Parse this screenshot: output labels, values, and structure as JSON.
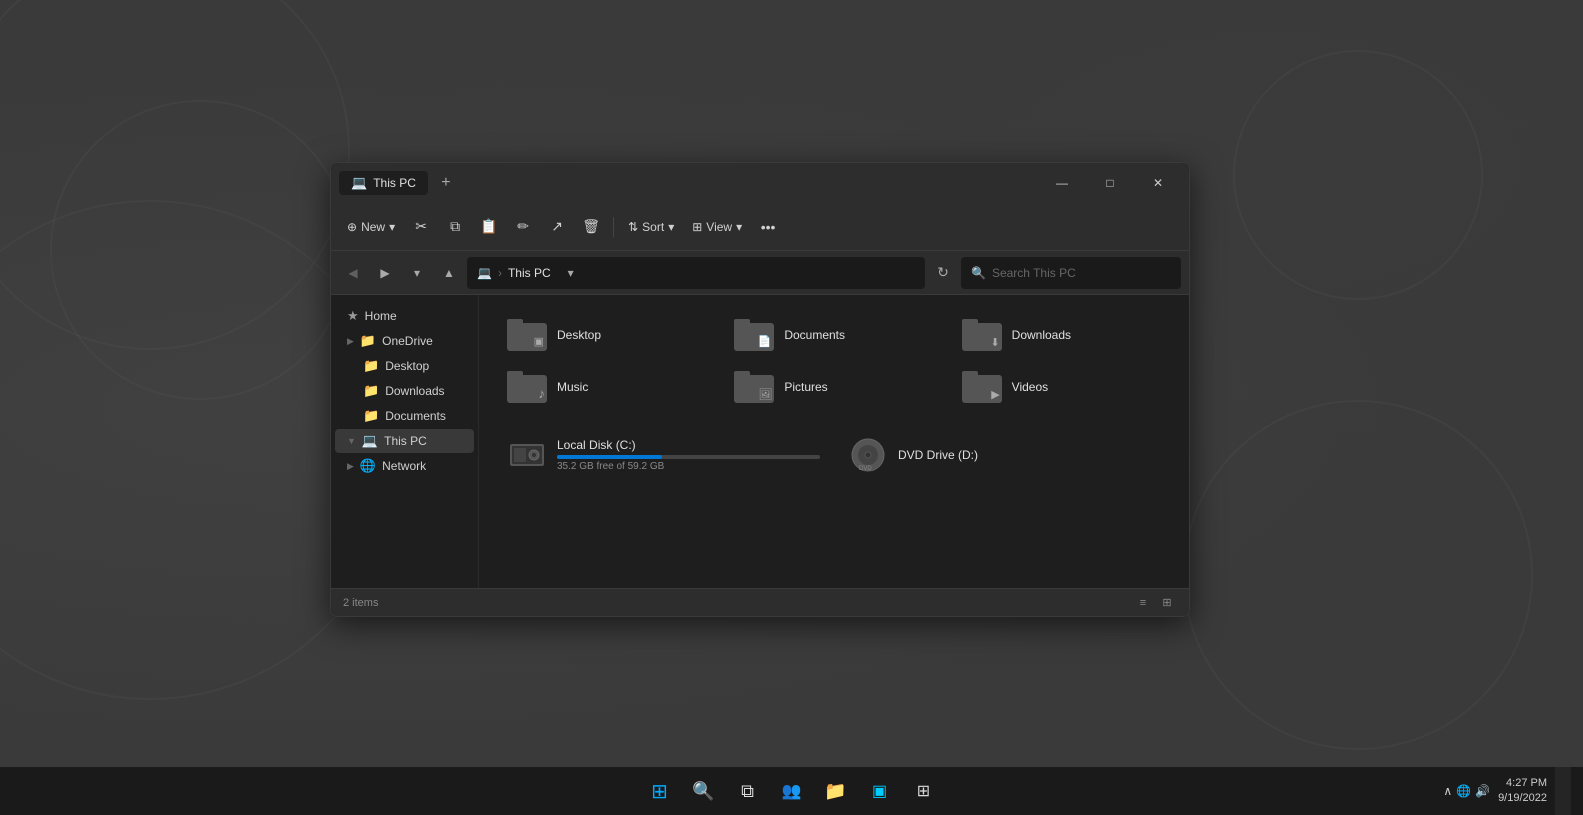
{
  "window": {
    "title": "This PC",
    "tab_label": "This PC",
    "add_tab": "+",
    "minimize": "—",
    "maximize": "□",
    "close": "✕"
  },
  "toolbar": {
    "new_label": "New",
    "sort_label": "Sort",
    "view_label": "View",
    "more_label": "•••",
    "new_chevron": "▾",
    "sort_chevron": "▾",
    "view_chevron": "▾"
  },
  "addressbar": {
    "pc_icon": "💻",
    "path_separator": ">",
    "path_text": "This PC",
    "refresh_icon": "↻",
    "search_placeholder": "Search This PC",
    "search_icon": "🔍"
  },
  "sidebar": {
    "items": [
      {
        "id": "home",
        "label": "Home",
        "icon": "★",
        "indent": 0,
        "has_chevron": false
      },
      {
        "id": "onedrive",
        "label": "OneDrive",
        "icon": "📁",
        "indent": 0,
        "has_chevron": true
      },
      {
        "id": "desktop-side",
        "label": "Desktop",
        "icon": "📁",
        "indent": 2,
        "has_chevron": false
      },
      {
        "id": "downloads-side",
        "label": "Downloads",
        "icon": "📁",
        "indent": 2,
        "has_chevron": false
      },
      {
        "id": "documents-side",
        "label": "Documents",
        "icon": "📁",
        "indent": 2,
        "has_chevron": false
      },
      {
        "id": "thispc",
        "label": "This PC",
        "icon": "💻",
        "indent": 0,
        "has_chevron": true,
        "active": true
      },
      {
        "id": "network",
        "label": "Network",
        "icon": "🌐",
        "indent": 0,
        "has_chevron": true
      }
    ]
  },
  "files": {
    "folders": [
      {
        "id": "desktop",
        "name": "Desktop",
        "badge": "▣"
      },
      {
        "id": "documents",
        "name": "Documents",
        "badge": "📄"
      },
      {
        "id": "downloads",
        "name": "Downloads",
        "badge": "⬇"
      },
      {
        "id": "music",
        "name": "Music",
        "badge": "♪"
      },
      {
        "id": "pictures",
        "name": "Pictures",
        "badge": "🖼"
      },
      {
        "id": "videos",
        "name": "Videos",
        "badge": "▶"
      }
    ],
    "drives": [
      {
        "id": "c-drive",
        "name": "Local Disk (C:)",
        "free": "35.2 GB free of 59.2 GB",
        "used_pct": 40,
        "icon": "💾"
      },
      {
        "id": "d-drive",
        "name": "DVD Drive (D:)",
        "free": "",
        "used_pct": 0,
        "icon": "💿"
      }
    ]
  },
  "statusbar": {
    "count_label": "2 items"
  },
  "taskbar": {
    "items": [
      {
        "id": "start",
        "icon": "⊞",
        "is_start": true
      },
      {
        "id": "search",
        "icon": "🔍"
      },
      {
        "id": "task-view",
        "icon": "⧉"
      },
      {
        "id": "teams",
        "icon": "👥"
      },
      {
        "id": "explorer",
        "icon": "📁"
      },
      {
        "id": "widgets",
        "icon": "▣"
      },
      {
        "id": "tiling",
        "icon": "⊞"
      }
    ],
    "system": {
      "time": "4:27 PM",
      "date": "9/19/2022",
      "volume_icon": "🔊",
      "network_icon": "🌐",
      "chevron_icon": "∧"
    }
  }
}
